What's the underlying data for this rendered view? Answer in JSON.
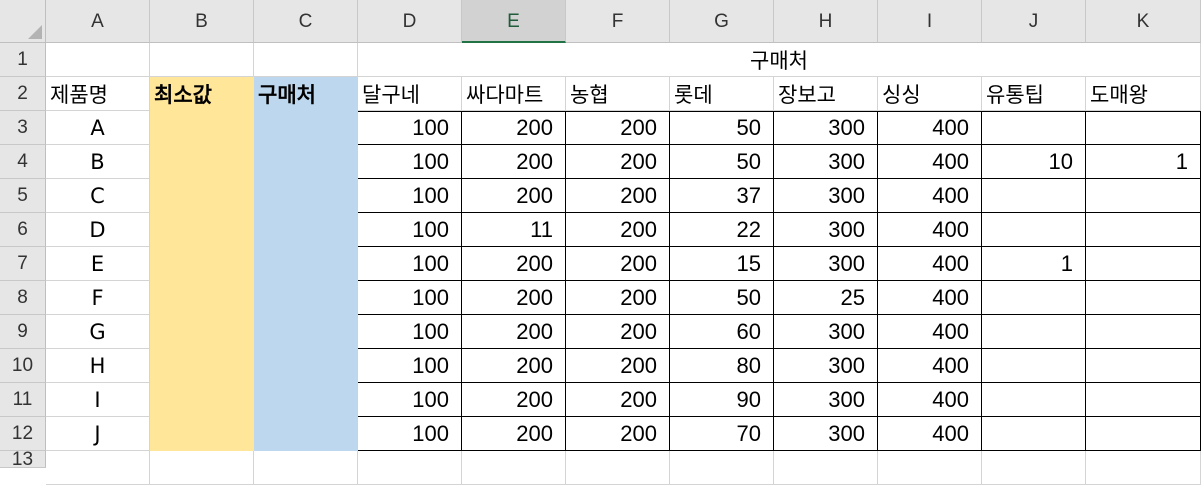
{
  "column_headers": [
    "A",
    "B",
    "C",
    "D",
    "E",
    "F",
    "G",
    "H",
    "I",
    "J",
    "K"
  ],
  "selected_column": "E",
  "row_headers": [
    "1",
    "2",
    "3",
    "4",
    "5",
    "6",
    "7",
    "8",
    "9",
    "10",
    "11",
    "12",
    "13"
  ],
  "row1": {
    "merged_title": "구매처"
  },
  "row2": {
    "product": "제품명",
    "min": "최소값",
    "buyer": "구매처",
    "stores": [
      "달구네",
      "싸다마트",
      "농협",
      "롯데",
      "장보고",
      "싱싱",
      "유통팁",
      "도매왕"
    ]
  },
  "rows": [
    {
      "product": "A",
      "values": [
        "100",
        "200",
        "200",
        "50",
        "300",
        "400",
        "",
        ""
      ]
    },
    {
      "product": "B",
      "values": [
        "100",
        "200",
        "200",
        "50",
        "300",
        "400",
        "10",
        "1"
      ]
    },
    {
      "product": "C",
      "values": [
        "100",
        "200",
        "200",
        "37",
        "300",
        "400",
        "",
        ""
      ]
    },
    {
      "product": "D",
      "values": [
        "100",
        "11",
        "200",
        "22",
        "300",
        "400",
        "",
        ""
      ]
    },
    {
      "product": "E",
      "values": [
        "100",
        "200",
        "200",
        "15",
        "300",
        "400",
        "1",
        ""
      ]
    },
    {
      "product": "F",
      "values": [
        "100",
        "200",
        "200",
        "50",
        "25",
        "400",
        "",
        ""
      ]
    },
    {
      "product": "G",
      "values": [
        "100",
        "200",
        "200",
        "60",
        "300",
        "400",
        "",
        ""
      ]
    },
    {
      "product": "H",
      "values": [
        "100",
        "200",
        "200",
        "80",
        "300",
        "400",
        "",
        ""
      ]
    },
    {
      "product": "I",
      "values": [
        "100",
        "200",
        "200",
        "90",
        "300",
        "400",
        "",
        ""
      ]
    },
    {
      "product": "J",
      "values": [
        "100",
        "200",
        "200",
        "70",
        "300",
        "400",
        "",
        ""
      ]
    }
  ],
  "colors": {
    "min_fill": "#ffe699",
    "buyer_fill": "#bdd7ee",
    "selected_header_accent": "#217346"
  }
}
